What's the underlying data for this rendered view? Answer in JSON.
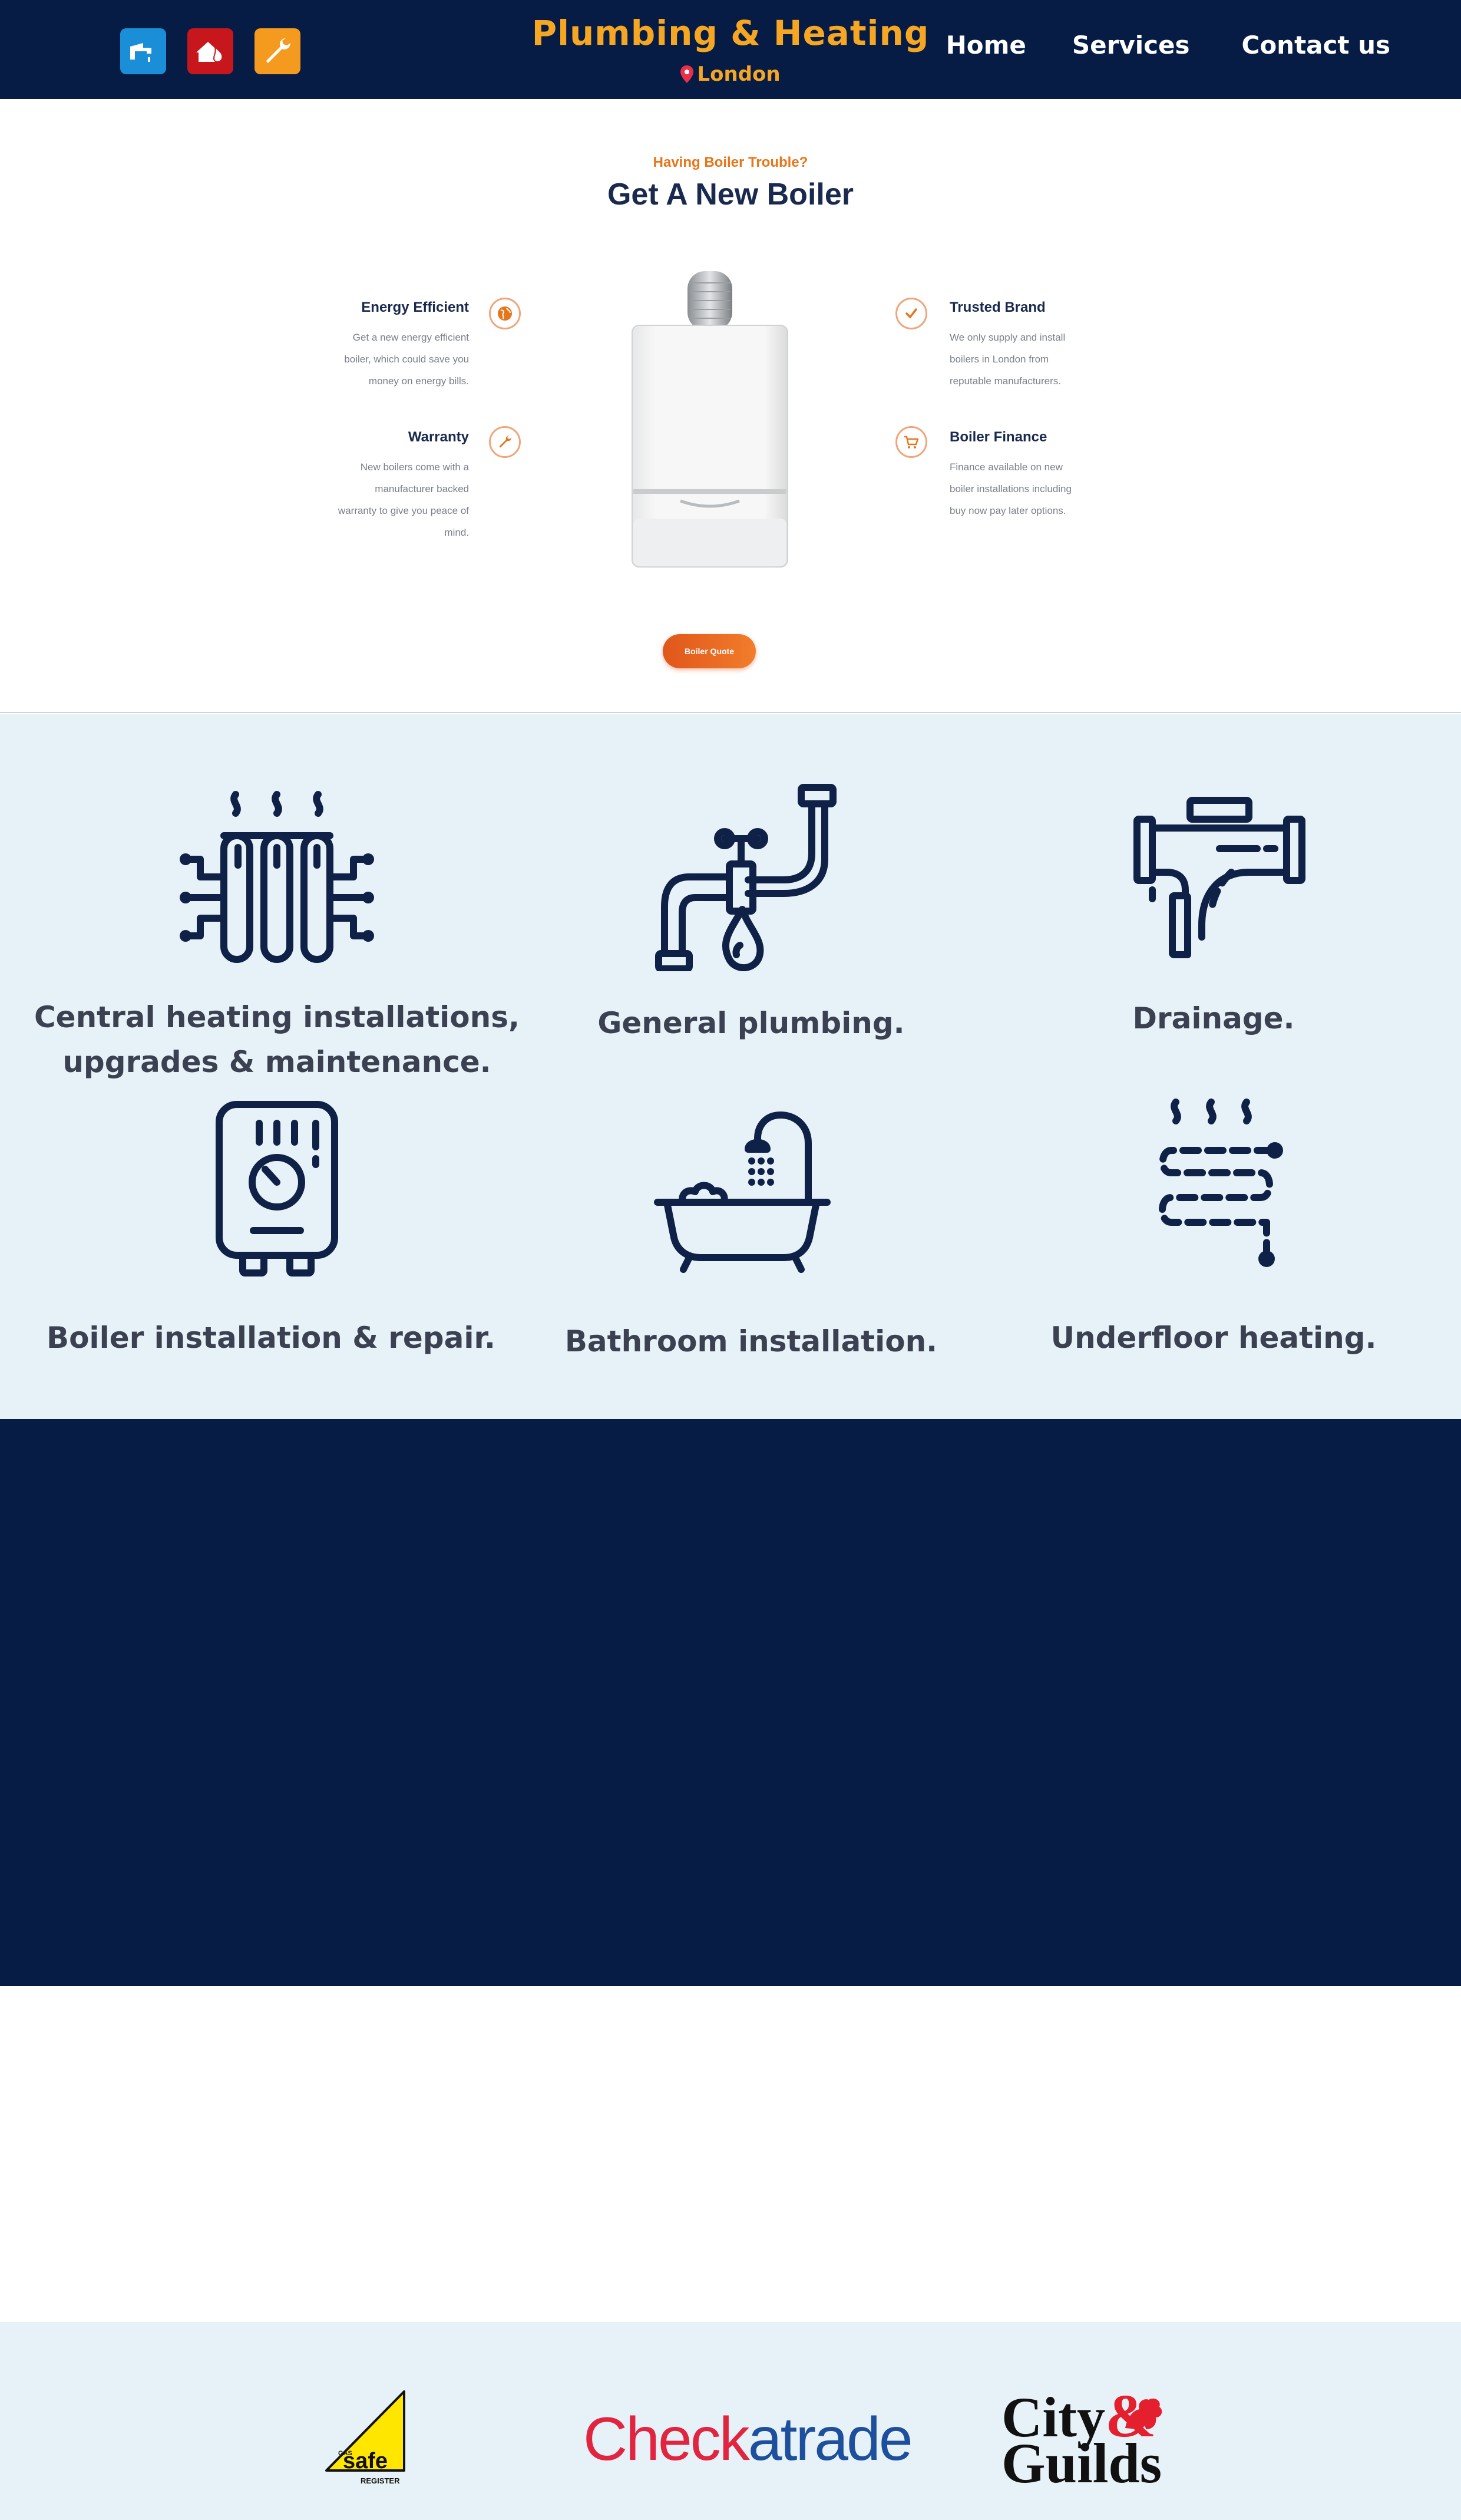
{
  "header": {
    "brand_title": "Plumbing & Heating",
    "brand_location": "London",
    "nav": [
      "Home",
      "Services",
      "Contact us"
    ],
    "icons": [
      "tap-icon",
      "fire-house-icon",
      "wrench-icon"
    ],
    "colors": {
      "background": "#061c45",
      "brand": "#f5a623"
    }
  },
  "boiler": {
    "kicker": "Having Boiler Trouble?",
    "title": "Get A New Boiler",
    "features": [
      {
        "title": "Energy Efficient",
        "text": [
          "Get a new energy efficient",
          "boiler, which could save you",
          "money on energy bills."
        ]
      },
      {
        "title": "Warranty",
        "text": [
          "New boilers come with a",
          "manufacturer backed",
          "warranty to give you peace of",
          "mind."
        ]
      },
      {
        "title": "Trusted Brand",
        "text": [
          "We only supply and install",
          "boilers in London from",
          "reputable manufacturers."
        ]
      },
      {
        "title": "Boiler Finance",
        "text": [
          "Finance available on new",
          "boiler installations including",
          "buy now pay later options."
        ]
      }
    ],
    "button": "Boiler Quote"
  },
  "services": [
    {
      "label_lines": [
        "Central heating installations,",
        "upgrades & maintenance."
      ],
      "icon": "radiator-icon"
    },
    {
      "label_lines": [
        "General plumbing."
      ],
      "icon": "pipe-tap-icon"
    },
    {
      "label_lines": [
        "Drainage."
      ],
      "icon": "drain-pipe-icon"
    },
    {
      "label_lines": [
        "Boiler installation & repair."
      ],
      "icon": "boiler-icon"
    },
    {
      "label_lines": [
        "Bathroom installation."
      ],
      "icon": "bathtub-icon"
    },
    {
      "label_lines": [
        "Underfloor heating."
      ],
      "icon": "underfloor-heating-icon"
    }
  ],
  "accreditations": {
    "gas_safe": {
      "top": "GAS",
      "main": "safe",
      "bottom": "REGISTER"
    },
    "checkatrade": {
      "part1": "Chec",
      "part2": "k",
      "part3": "a",
      "part4": "trade"
    },
    "city_guilds": {
      "line1": "City",
      "amp": "&",
      "line2": "Guilds"
    }
  }
}
